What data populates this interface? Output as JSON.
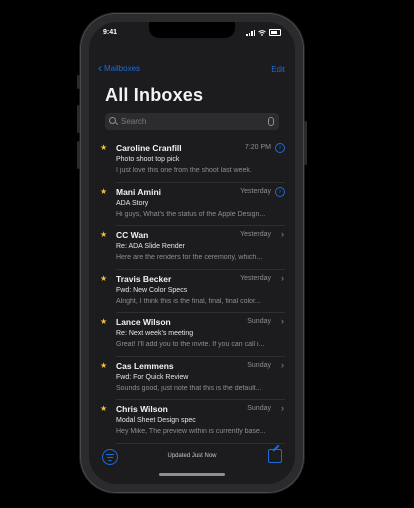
{
  "status": {
    "time": "9:41"
  },
  "nav": {
    "back_label": "Mailboxes",
    "edit_label": "Edit"
  },
  "title": "All Inboxes",
  "search": {
    "placeholder": "Search"
  },
  "messages": [
    {
      "sender": "Caroline Cranfill",
      "date": "7:20 PM",
      "subject": "Photo shoot top pick",
      "preview": "I just love this one from the shoot last week.",
      "starred": true,
      "disclosure": "circle"
    },
    {
      "sender": "Mani Amini",
      "date": "Yesterday",
      "subject": "ADA Story",
      "preview": "Hi guys, What's the status of the Apple Design...",
      "starred": true,
      "disclosure": "circle"
    },
    {
      "sender": "CC Wan",
      "date": "Yesterday",
      "subject": "Re: ADA Slide Render",
      "preview": "Here are the renders for the ceremony, which...",
      "starred": true,
      "disclosure": "chevron"
    },
    {
      "sender": "Travis Becker",
      "date": "Yesterday",
      "subject": "Fwd: New Color Specs",
      "preview": "Alright, I think this is the final, final, final color...",
      "starred": true,
      "disclosure": "chevron"
    },
    {
      "sender": "Lance Wilson",
      "date": "Sunday",
      "subject": "Re: Next week's meeting",
      "preview": "Great! I'll add you to the invite. If you can call i...",
      "starred": true,
      "disclosure": "chevron"
    },
    {
      "sender": "Cas Lemmens",
      "date": "Sunday",
      "subject": "Fwd: For Quick Review",
      "preview": "Sounds good, just note that this is the default...",
      "starred": true,
      "disclosure": "chevron"
    },
    {
      "sender": "Chris Wilson",
      "date": "Sunday",
      "subject": "Modal Sheet Design spec",
      "preview": "Hey Mike, The preview within is currently base...",
      "starred": true,
      "disclosure": "chevron"
    }
  ],
  "toolbar": {
    "updated": "Updated Just Now"
  },
  "colors": {
    "accent": "#1e6bd6",
    "star": "#f6c334",
    "background": "#1c1c1e"
  }
}
